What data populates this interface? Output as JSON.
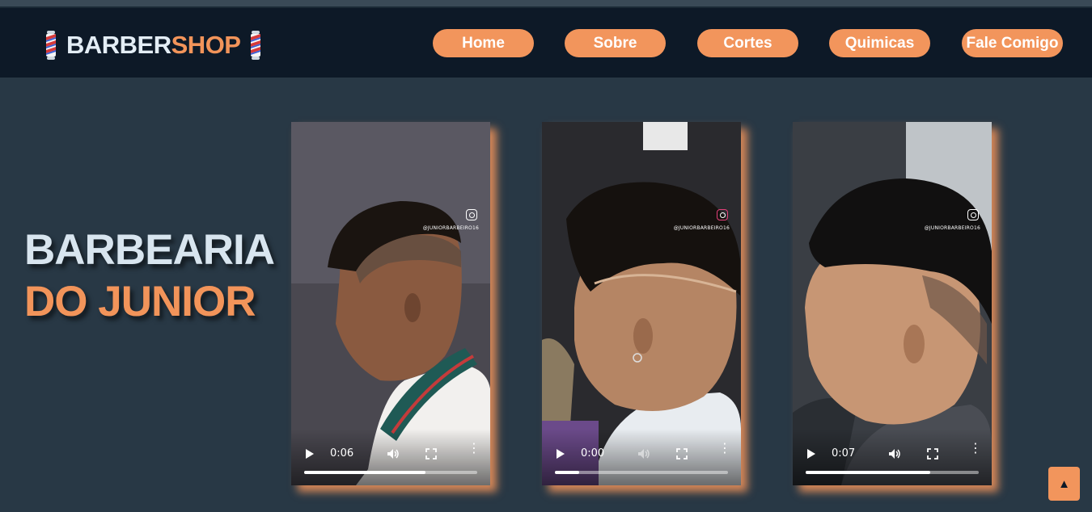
{
  "header": {
    "logo_part1": "BARBER",
    "logo_part2": "SHOP",
    "nav": [
      "Home",
      "Sobre",
      "Cortes",
      "Quimicas",
      "Fale Comigo"
    ]
  },
  "hero": {
    "line1": "BARBEARIA",
    "line2": "DO JUNIOR"
  },
  "videos": [
    {
      "time": "0:06",
      "progress": 0.7,
      "handle": "@JUNIORBARBEIRO16",
      "icon": "instagram-icon"
    },
    {
      "time": "0:00",
      "progress": 0.14,
      "handle": "@JUNIORBARBEIRO16",
      "icon": "instagram-icon"
    },
    {
      "time": "0:07",
      "progress": 0.72,
      "handle": "@JUNIORBARBEIRO16",
      "icon": "instagram-icon"
    }
  ],
  "scroll_top": {
    "icon": "arrow-up-icon",
    "glyph": "▲"
  },
  "colors": {
    "accent": "#f2955c",
    "header_bg": "#0d1927",
    "page_bg": "#283845",
    "title_light": "#d8e5ef"
  }
}
